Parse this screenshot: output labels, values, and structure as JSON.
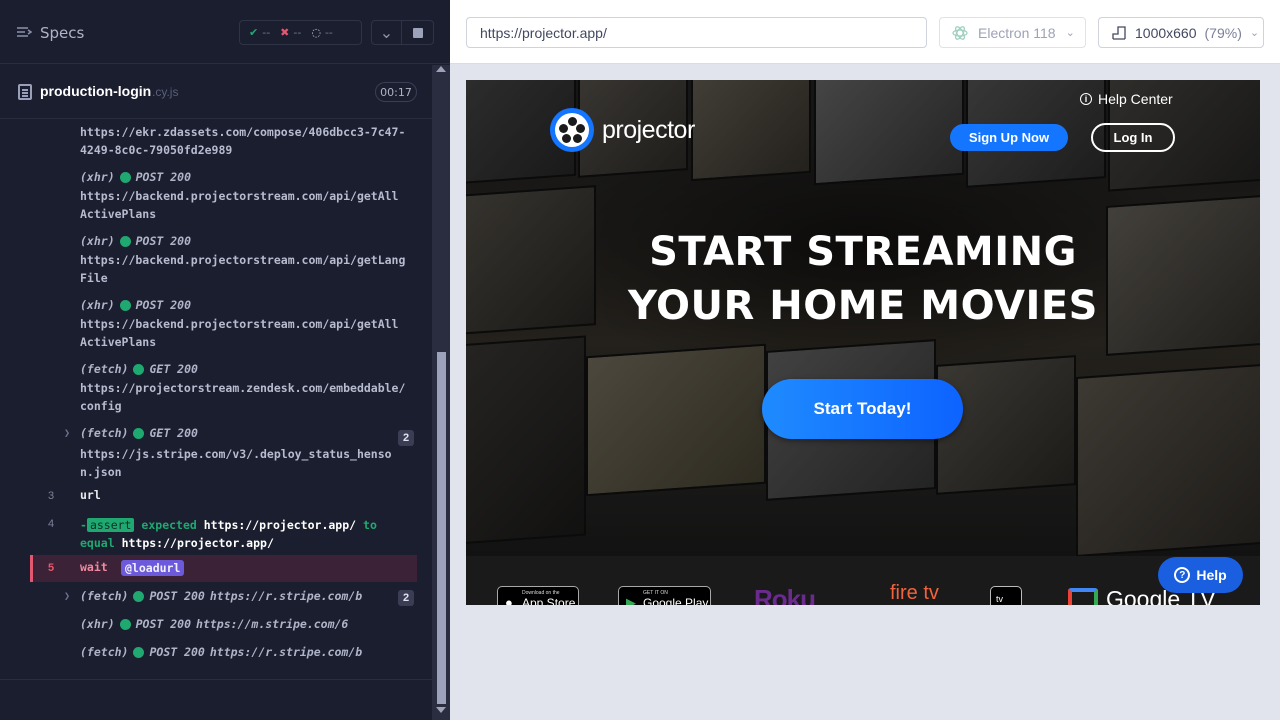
{
  "reporter": {
    "specs_label": "Specs",
    "stats": {
      "passed": "--",
      "failed": "--",
      "pending": "--"
    },
    "spec_name": "production-login",
    "spec_ext": ".cy.js",
    "timer": "00:17"
  },
  "log": {
    "entry0": {
      "url": "https://ekr.zdassets.com/compose/406dbcc3-7c47-\n4249-8c0c-79050fd2e989"
    },
    "entry1": {
      "type": "(xhr)",
      "method": "POST 200",
      "url": "https://backend.projectorstream.com/api/getAll\nActivePlans"
    },
    "entry2": {
      "type": "(xhr)",
      "method": "POST 200",
      "url": "https://backend.projectorstream.com/api/getLang\nFile"
    },
    "entry3": {
      "type": "(xhr)",
      "method": "POST 200",
      "url": "https://backend.projectorstream.com/api/getAll\nActivePlans"
    },
    "entry4": {
      "type": "(fetch)",
      "method": "GET 200",
      "url": "https://projectorstream.zendesk.com/embeddable/\nconfig"
    },
    "entry5": {
      "type": "(fetch)",
      "method": "GET 200",
      "url": "https://js.stripe.com/v3/.deploy_status_henso\nn.json",
      "count": "2"
    },
    "cmd3": {
      "num": "3",
      "name": "url"
    },
    "cmd4": {
      "num": "4",
      "prefix": "-",
      "assert": "assert",
      "expected": "expected",
      "expected_val": "https://projector.app/",
      "to": "to",
      "equal": "equal",
      "equal_val": "https://projector.app/"
    },
    "cmd5": {
      "num": "5",
      "name": "wait",
      "alias": "@loadurl"
    },
    "entry6": {
      "type": "(fetch)",
      "method": "POST 200",
      "url": "https://r.stripe.com/b",
      "count": "2"
    },
    "entry7": {
      "type": "(xhr)",
      "method": "POST 200",
      "url": "https://m.stripe.com/6"
    },
    "entry8": {
      "type": "(fetch)",
      "method": "POST 200",
      "url": "https://r.stripe.com/b"
    }
  },
  "toolbar": {
    "url": "https://projector.app/",
    "browser": "Electron 118",
    "viewport": "1000x660",
    "zoom": "(79%)"
  },
  "site": {
    "logo_text": "projector",
    "help_center": "Help Center",
    "signup": "Sign Up Now",
    "login": "Log In",
    "headline_1": "START STREAMING",
    "headline_2": "YOUR HOME MOVIES",
    "cta": "Start Today!",
    "appstore_small": "Download on the",
    "appstore_large": "App Store",
    "googleplay_small": "GET IT ON",
    "googleplay_large": "Google Play",
    "roku": "Roku",
    "firetv": "fire tv",
    "appletv": "tv",
    "googletv": "Google TV",
    "help_button": "Help"
  },
  "colors": {
    "accent_blue": "#1476ff",
    "pass_green": "#1fa971",
    "fail_red": "#e45770",
    "alias_purple": "#6c5adb"
  }
}
